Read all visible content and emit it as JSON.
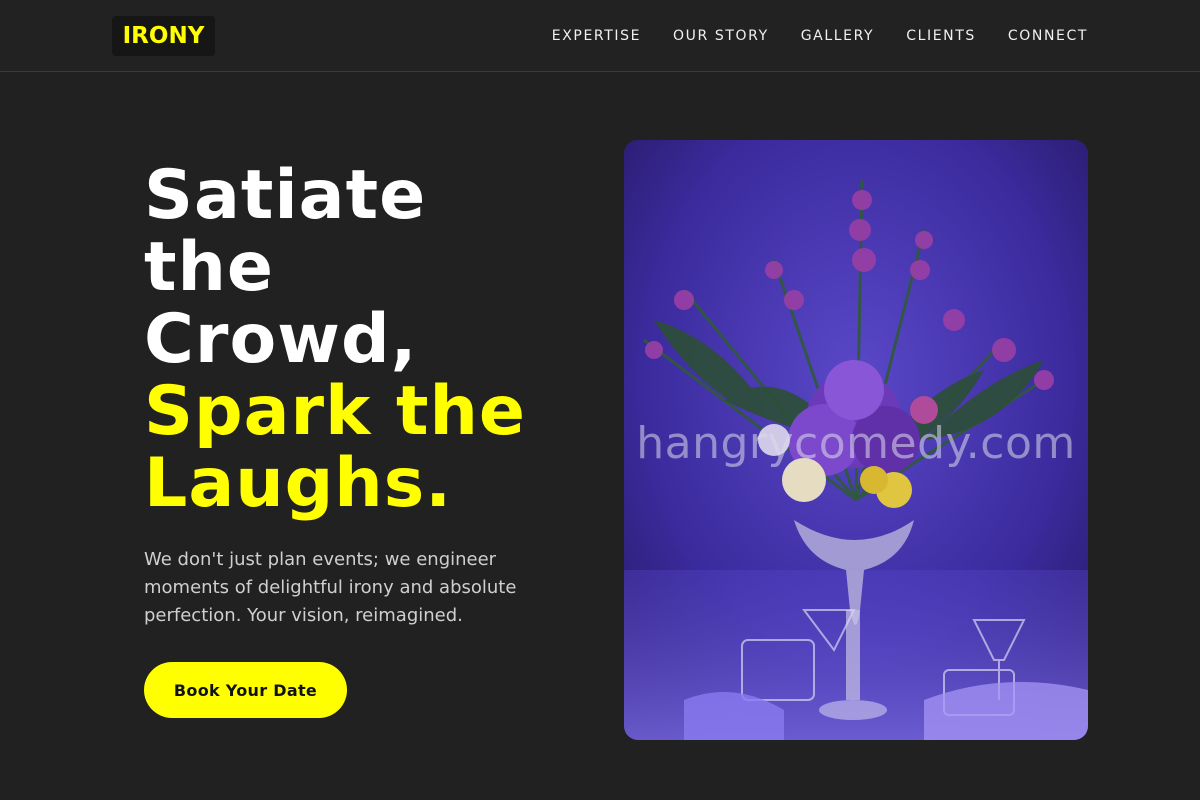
{
  "brand": {
    "logo_text": "IRONY",
    "accent_color": "#ffff00"
  },
  "nav": {
    "items": [
      {
        "label": "EXPERTISE"
      },
      {
        "label": "OUR STORY"
      },
      {
        "label": "GALLERY"
      },
      {
        "label": "CLIENTS"
      },
      {
        "label": "CONNECT"
      }
    ]
  },
  "hero": {
    "title_lines": [
      "Satiate",
      "the",
      "Crowd,"
    ],
    "highlight_lines": [
      "Spark the",
      "Laughs."
    ],
    "subtitle": "We don't just plan events; we engineer moments of delightful irony and absolute perfection. Your vision, reimagined.",
    "cta_label": "Book Your Date",
    "image": {
      "description_icon": "floral-centerpiece-photo",
      "watermark": "hangrycomedy.com"
    }
  }
}
